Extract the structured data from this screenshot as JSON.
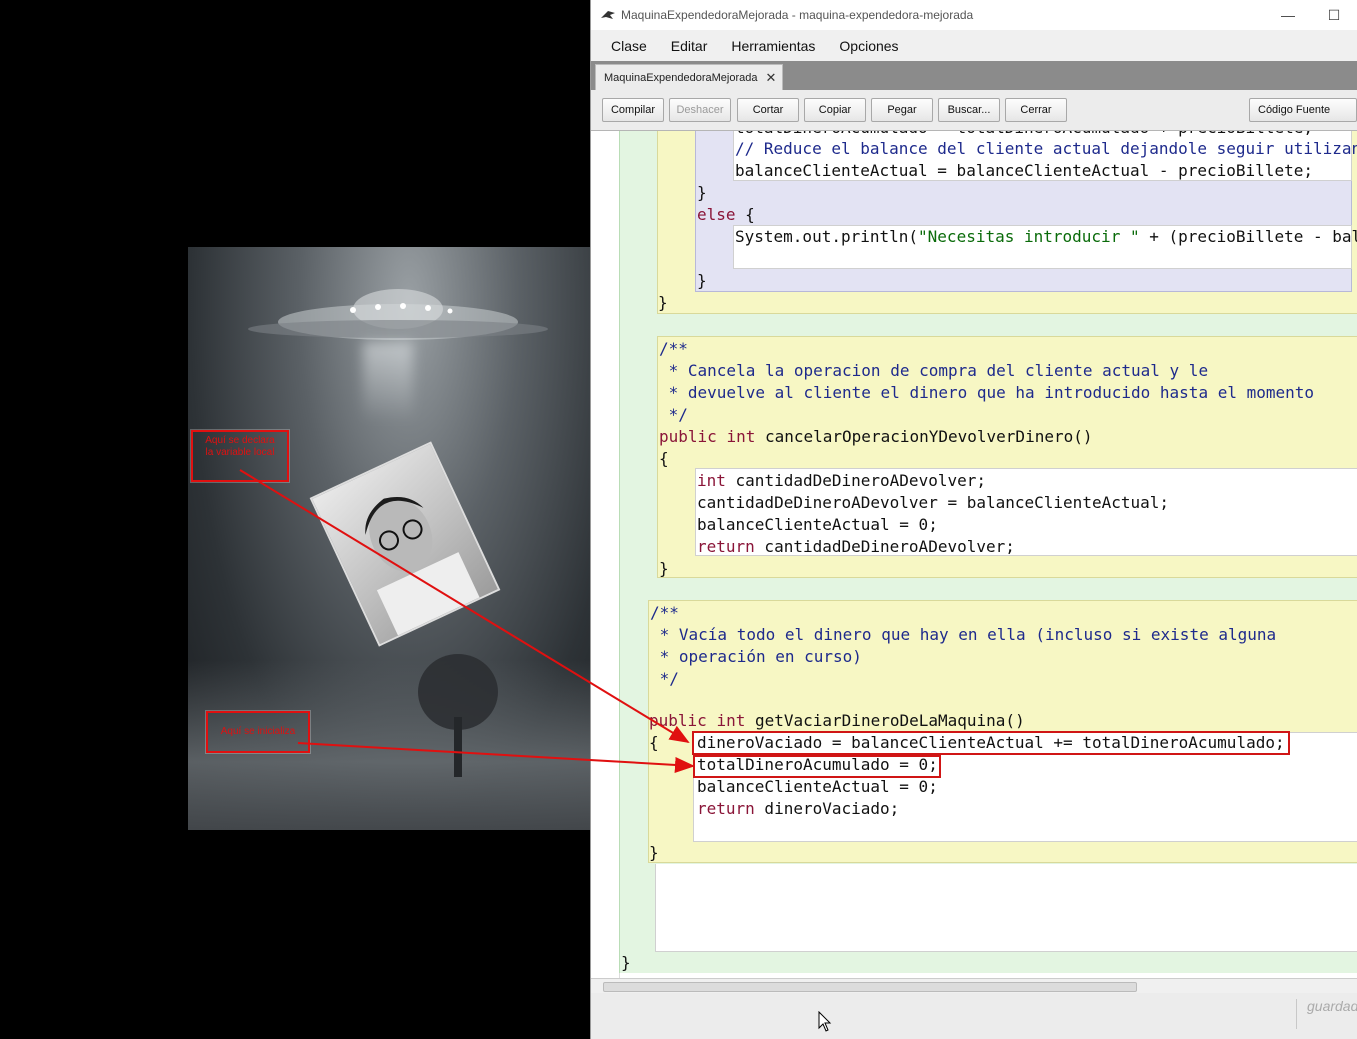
{
  "window": {
    "title": "MaquinaExpendedoraMejorada - maquina-expendedora-mejorada",
    "minimize": "—",
    "maximize": "☐"
  },
  "menu": [
    "Clase",
    "Editar",
    "Herramientas",
    "Opciones"
  ],
  "tab": {
    "label": "MaquinaExpendedoraMejorada",
    "close": "✕"
  },
  "toolbar": {
    "compile": "Compilar",
    "undo": "Deshacer",
    "cut": "Cortar",
    "copy": "Copiar",
    "paste": "Pegar",
    "find": "Buscar...",
    "close": "Cerrar",
    "view": "Código Fuente"
  },
  "annotations": {
    "local_var": "Aquí se declara\nla variable local",
    "init": "Aquí se inicializa"
  },
  "code": {
    "top_partial": "totalDineroAcumulado = totalDineroAcumulado + precioBillete;",
    "top_comment": "// Reduce el balance del cliente actual dejandole seguir utilizan",
    "top_balance": "balanceClienteActual = balanceClienteActual - precioBillete;",
    "close_brace": "}",
    "else_kw": "else",
    "else_open": " {",
    "println_a": "System.out.println(",
    "println_str": "\"Necesitas introducir \"",
    "println_b": " + (precioBillete - bal",
    "cancel_doc": [
      "/**",
      " * Cancela la operacion de compra del cliente actual y le",
      " * devuelve al cliente el dinero que ha introducido hasta el momento",
      " */"
    ],
    "cancel_public": "public",
    "cancel_int": "int",
    "cancel_name": " cancelarOperacionYDevolverDinero()",
    "open_brace": "{",
    "cancel_l1_int": "int",
    "cancel_l1": " cantidadDeDineroADevolver;",
    "cancel_l2": "cantidadDeDineroADevolver = balanceClienteActual;",
    "cancel_l3": "balanceClienteActual = 0;",
    "cancel_l4_ret": "return",
    "cancel_l4": " cantidadDeDineroADevolver;",
    "vaciar_doc": [
      "/**",
      " * Vacía todo el dinero que hay en ella (incluso si existe alguna",
      " * operación en curso)",
      " */"
    ],
    "vaciar_name": " getVaciarDineroDeLaMaquina()",
    "vaciar_l1": "dineroVaciado = balanceClienteActual += totalDineroAcumulado;",
    "vaciar_l2": "totalDineroAcumulado = 0;",
    "vaciar_l3": "balanceClienteActual = 0;",
    "vaciar_l4_ret": "return",
    "vaciar_l4": " dineroVaciado;"
  },
  "status": {
    "message": "guardad"
  },
  "colors": {
    "keyword": "#8a1538",
    "comment": "#1e2a8c",
    "string": "#0a6b0a",
    "annotation": "#e01010"
  }
}
